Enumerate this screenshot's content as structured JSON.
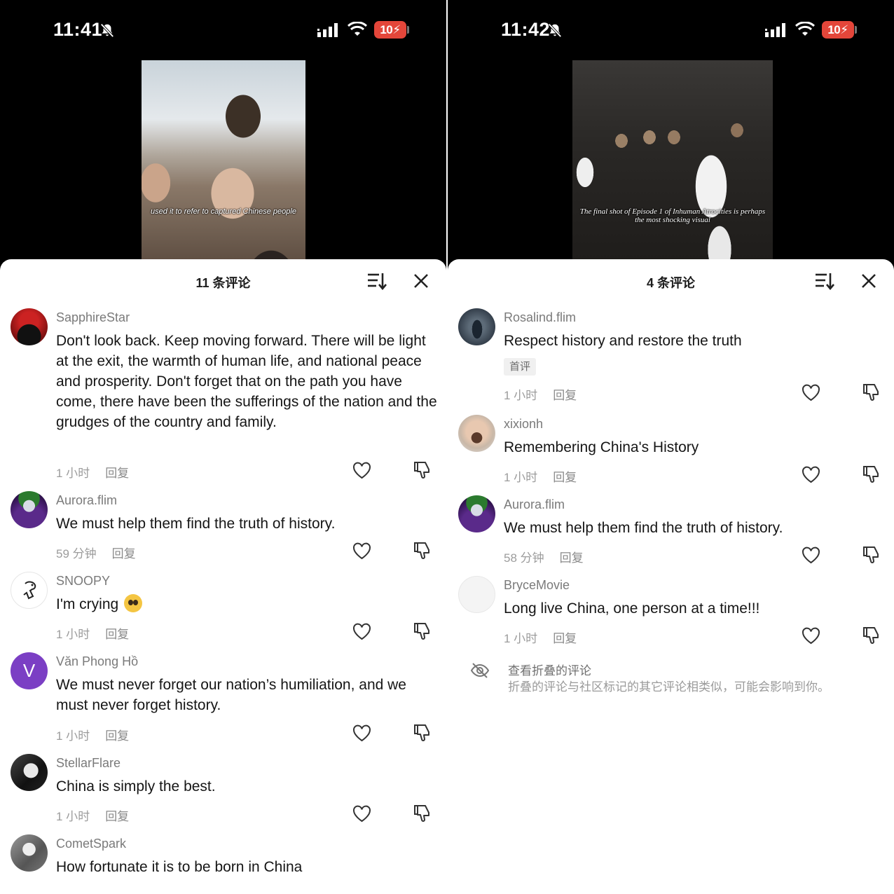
{
  "left": {
    "status": {
      "time": "11:41",
      "battery": "10"
    },
    "video": {
      "caption": "used it to refer to captured Chinese people"
    },
    "header": {
      "title": "11 条评论"
    },
    "comments": [
      {
        "user": "SapphireStar",
        "text": "Don't look back. Keep moving forward. There will be light at the exit, the warmth of human life, and national peace and prosperity. Don't forget that on the path you have come, there have been the sufferings of the nation and the grudges of the country and family.",
        "time": "1 小时",
        "reply": "回复"
      },
      {
        "user": "Aurora.flim",
        "text": "We must help them find the truth of history.",
        "time": "59 分钟",
        "reply": "回复"
      },
      {
        "user": "SNOOPY",
        "text": "I'm crying",
        "emoji": "pleading-face",
        "time": "1 小时",
        "reply": "回复"
      },
      {
        "user": "Văn Phong Hồ",
        "avatar_letter": "V",
        "text": "We must never forget our nation’s humiliation, and we must never forget history.",
        "time": "1 小时",
        "reply": "回复"
      },
      {
        "user": "StellarFlare",
        "text": "China is simply the best.",
        "time": "1 小时",
        "reply": "回复"
      },
      {
        "user": "CometSpark",
        "text": "How fortunate it is to be born in China"
      }
    ]
  },
  "right": {
    "status": {
      "time": "11:42",
      "battery": "10"
    },
    "video": {
      "caption": "The final shot of Episode 1 of Inhuman Atrocities is perhaps the most shocking visual"
    },
    "header": {
      "title": "4 条评论"
    },
    "comments": [
      {
        "user": "Rosalind.flim",
        "text": "Respect history and restore the truth",
        "badge": "首评",
        "time": "1 小时",
        "reply": "回复"
      },
      {
        "user": "xixionh",
        "text": "Remembering China's History",
        "time": "1 小时",
        "reply": "回复"
      },
      {
        "user": "Aurora.flim",
        "text": "We must help them find the truth of history.",
        "time": "58 分钟",
        "reply": "回复"
      },
      {
        "user": "BryceMovie",
        "text": "Long live China, one person at a time!!!",
        "time": "1 小时",
        "reply": "回复"
      }
    ],
    "collapsed": {
      "title": "查看折叠的评论",
      "description": "折叠的评论与社区标记的其它评论相类似，可能会影响到你。"
    }
  },
  "colors": {
    "battery": "#e4463a",
    "avatar_v": "#7b3fc4",
    "text_primary": "#161616",
    "text_secondary": "#7a7a7a"
  },
  "icons": [
    "bell-slash-icon",
    "signal-icon",
    "wifi-icon",
    "sort-icon",
    "close-icon",
    "heart-icon",
    "dislike-icon",
    "eye-slash-icon"
  ]
}
